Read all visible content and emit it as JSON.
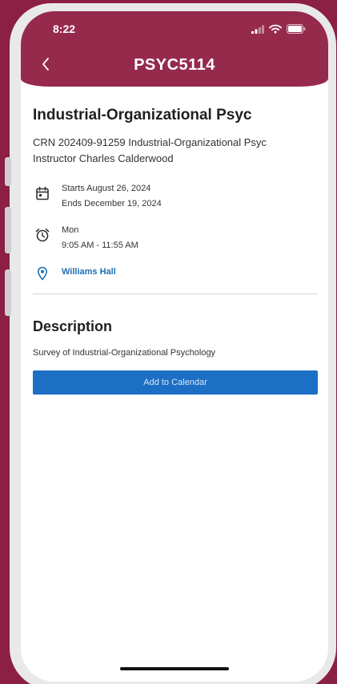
{
  "status_bar": {
    "time": "8:22"
  },
  "header": {
    "title": "PSYC5114",
    "back_icon": "chevron-left-icon"
  },
  "course": {
    "name": "Industrial-Organizational Psyc",
    "crn_line": "CRN 202409-91259 Industrial-Organizational Psyc",
    "instructor_line": "Instructor Charles Calderwood"
  },
  "schedule": {
    "starts": "Starts August 26, 2024",
    "ends": "Ends December 19, 2024",
    "day": "Mon",
    "time": "9:05 AM - 11:55 AM",
    "location": "Williams Hall"
  },
  "description": {
    "heading": "Description",
    "text": "Survey of Industrial-Organizational Psychology"
  },
  "actions": {
    "add_to_calendar": "Add to Calendar"
  },
  "colors": {
    "header": "#962a4c",
    "background": "#8c1f44",
    "accent": "#1c6fc4",
    "link": "#1c6fb5"
  }
}
